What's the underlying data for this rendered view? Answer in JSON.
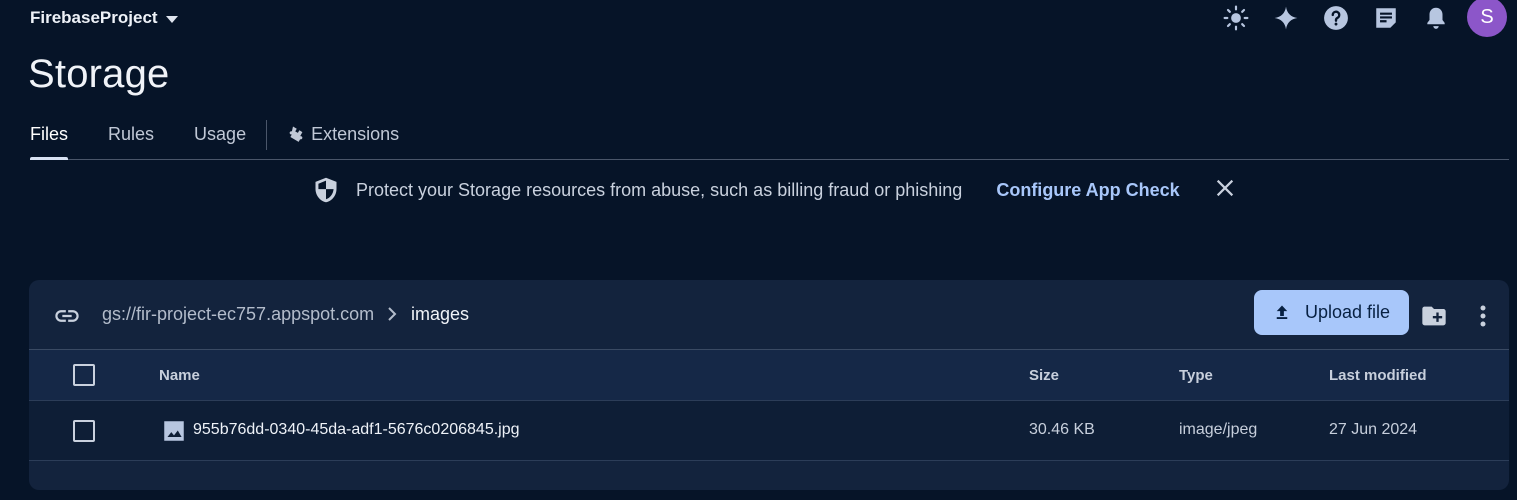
{
  "header": {
    "project_name": "FirebaseProject",
    "avatar_initial": "S",
    "icons": [
      "brightness-icon",
      "sparkle-icon",
      "help-icon",
      "feedback-icon",
      "notifications-icon"
    ]
  },
  "page": {
    "title": "Storage"
  },
  "tabs": [
    {
      "label": "Files",
      "active": true
    },
    {
      "label": "Rules",
      "active": false
    },
    {
      "label": "Usage",
      "active": false
    },
    {
      "label": "Extensions",
      "active": false
    }
  ],
  "banner": {
    "text": "Protect your Storage resources from abuse, such as billing fraud or phishing",
    "link": "Configure App Check"
  },
  "browser": {
    "bucket": "gs://fir-project-ec757.appspot.com",
    "current_folder": "images",
    "upload_label": "Upload file"
  },
  "table": {
    "columns": {
      "name": "Name",
      "size": "Size",
      "type": "Type",
      "modified": "Last modified"
    },
    "rows": [
      {
        "name": "955b76dd-0340-45da-adf1-5676c0206845.jpg",
        "size": "30.46 KB",
        "type": "image/jpeg",
        "modified": "27 Jun 2024"
      }
    ]
  },
  "colors": {
    "background": "#061428",
    "panel": "#13233d",
    "accent": "#a8c7fa",
    "avatar": "#8c56c9"
  }
}
